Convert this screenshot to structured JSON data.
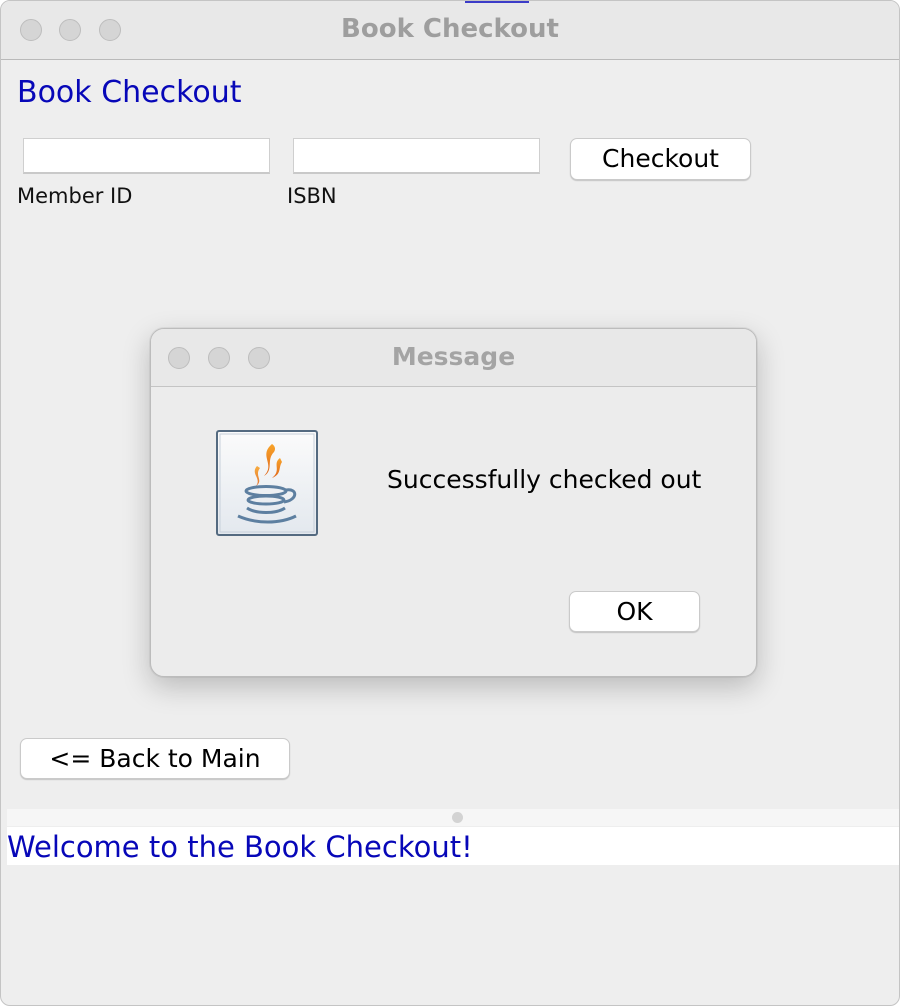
{
  "window": {
    "title": "Book Checkout"
  },
  "form": {
    "heading": "Book Checkout",
    "member_id": {
      "label": "Member ID",
      "value": ""
    },
    "isbn": {
      "label": "ISBN",
      "value": ""
    },
    "checkout_label": "Checkout",
    "back_label": "<= Back to Main"
  },
  "dialog": {
    "title": "Message",
    "icon": "java-cup-icon",
    "message": "Successfully checked out",
    "ok_label": "OK"
  },
  "status": {
    "text": "Welcome to the Book Checkout!"
  },
  "colors": {
    "accent_text": "#0707b8",
    "window_bg": "#eeeeee",
    "titlebar_text": "#9e9e9e"
  }
}
